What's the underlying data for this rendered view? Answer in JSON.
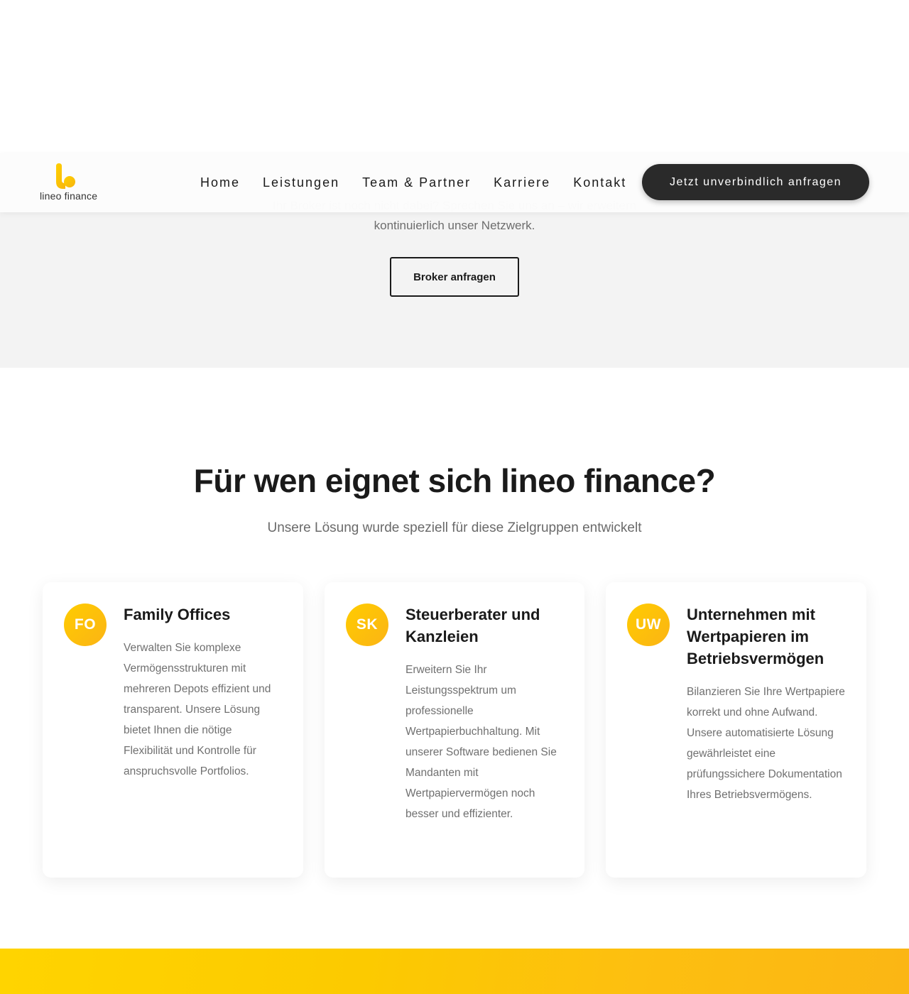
{
  "nav": {
    "logo_text": "lineo finance",
    "links": [
      "Home",
      "Leistungen",
      "Team & Partner",
      "Karriere",
      "Kontakt"
    ],
    "cta_label": "Jetzt unverbindlich anfragen"
  },
  "broker": {
    "text_line1": "Ihr Broker ist noch nicht dabei? Sprechen Sie uns an – wir erweitern",
    "text_line2": "kontinuierlich unser Netzwerk.",
    "button_label": "Broker anfragen"
  },
  "target": {
    "title": "Für wen eignet sich lineo finance?",
    "subtitle": "Unsere Lösung wurde speziell für diese Zielgruppen entwickelt",
    "cards": [
      {
        "badge": "FO",
        "title": "Family Offices",
        "description": "Verwalten Sie komplexe Vermögensstrukturen mit mehreren Depots effizient und transparent. Unsere Lösung bietet Ihnen die nötige Flexibilität und Kontrolle für anspruchsvolle Portfolios."
      },
      {
        "badge": "SK",
        "title": "Steuerberater und Kanzleien",
        "description": "Erweitern Sie Ihr Leistungsspektrum um professionelle Wertpapierbuchhaltung. Mit unserer Software bedienen Sie Mandanten mit Wertpapiervermögen noch besser und effizienter."
      },
      {
        "badge": "UW",
        "title": "Unternehmen mit Wertpapieren im Betriebsvermögen",
        "description": "Bilanzieren Sie Ihre Wertpapiere korrekt und ohne Aufwand. Unsere automatisierte Lösung gewährleistet eine prüfungssichere Dokumentation Ihres Betriebsvermögens."
      }
    ]
  },
  "colors": {
    "accent": "#fcc400",
    "dark": "#2a2a2a",
    "section_bg": "#f3f3f3"
  }
}
